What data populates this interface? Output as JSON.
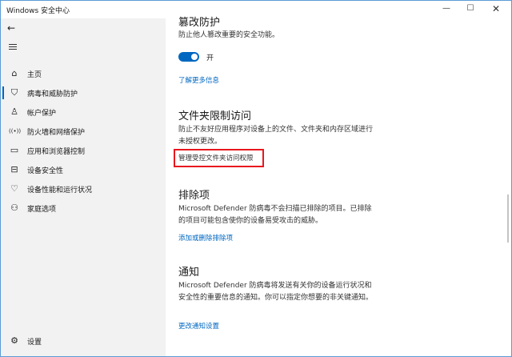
{
  "window": {
    "title": "Windows 安全中心",
    "controls": {
      "minimize": "—",
      "maximize": "☐",
      "close": "✕"
    }
  },
  "sidebar": {
    "back_glyph": "←",
    "items": [
      {
        "label": "主页",
        "icon": "home-icon",
        "glyph": "⌂",
        "active": false
      },
      {
        "label": "病毒和威胁防护",
        "icon": "shield-icon",
        "glyph": "⛉",
        "active": true
      },
      {
        "label": "帐户保护",
        "icon": "person-icon",
        "glyph": "♙",
        "active": false
      },
      {
        "label": "防火墙和网络保护",
        "icon": "wifi-icon",
        "glyph": "((•))",
        "active": false
      },
      {
        "label": "应用和浏览器控制",
        "icon": "app-window-icon",
        "glyph": "▭",
        "active": false
      },
      {
        "label": "设备安全性",
        "icon": "laptop-icon",
        "glyph": "⊟",
        "active": false
      },
      {
        "label": "设备性能和运行状况",
        "icon": "heart-icon",
        "glyph": "♡",
        "active": false
      },
      {
        "label": "家庭选项",
        "icon": "family-icon",
        "glyph": "⚇",
        "active": false
      }
    ],
    "settings": {
      "label": "设置",
      "icon": "gear-icon",
      "glyph": "⚙"
    }
  },
  "main": {
    "tamper": {
      "title": "篡改防护",
      "desc": "防止他人篡改重要的安全功能。",
      "toggle_label": "开",
      "toggle_on": true,
      "link": "了解更多信息"
    },
    "folder_access": {
      "title": "文件夹限制访问",
      "desc": "防止不友好应用程序对设备上的文件、文件夹和内存区域进行未授权更改。",
      "link": "管理受控文件夹访问权限"
    },
    "exclusions": {
      "title": "排除项",
      "desc": "Microsoft Defender 防病毒不会扫描已排除的项目。已排除的项目可能包含使你的设备易受攻击的威胁。",
      "link": "添加或删除排除项"
    },
    "notifications": {
      "title": "通知",
      "desc": "Microsoft Defender 防病毒将发送有关你的设备运行状况和安全性的重要信息的通知。你可以指定你想要的非关键通知。",
      "link": "更改通知设置"
    }
  },
  "colors": {
    "accent": "#0067c0",
    "highlight": "#e8171e",
    "sidebar_bg": "#f2f2f2"
  }
}
